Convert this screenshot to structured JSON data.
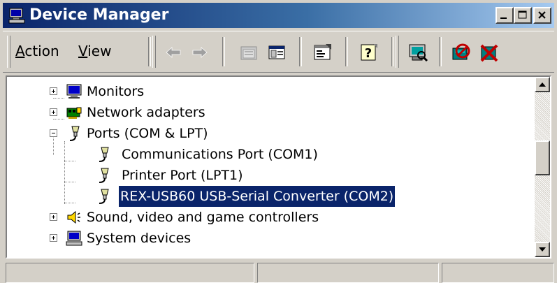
{
  "window": {
    "title": "Device Manager",
    "colors": {
      "titlebar_start": "#0a246a",
      "titlebar_end": "#a6caf0",
      "face": "#d4d0c8",
      "selection": "#0a246a"
    }
  },
  "caption_buttons": [
    {
      "name": "minimize",
      "icon": "minimize-icon"
    },
    {
      "name": "maximize",
      "icon": "maximize-icon"
    },
    {
      "name": "close",
      "icon": "close-icon"
    }
  ],
  "menu": {
    "action": {
      "label_accel": "A",
      "label_rest": "ction"
    },
    "view": {
      "label_accel": "V",
      "label_rest": "iew"
    }
  },
  "toolbar_buttons": [
    {
      "name": "back",
      "icon": "back-arrow-icon",
      "enabled": false
    },
    {
      "name": "forward",
      "icon": "forward-arrow-icon",
      "enabled": false
    },
    {
      "name": "up-folder",
      "icon": "folder-icon",
      "enabled": false
    },
    {
      "name": "show-hide-tree",
      "icon": "console-tree-icon",
      "enabled": true
    },
    {
      "name": "properties",
      "icon": "properties-icon",
      "enabled": true
    },
    {
      "name": "help",
      "icon": "help-icon",
      "enabled": true
    },
    {
      "name": "scan-hardware",
      "icon": "scan-hardware-icon",
      "enabled": true
    },
    {
      "name": "disable",
      "icon": "disable-device-icon",
      "enabled": true
    },
    {
      "name": "uninstall",
      "icon": "uninstall-icon",
      "enabled": true
    }
  ],
  "tree": {
    "items": [
      {
        "label": "Monitors",
        "icon": "monitor-icon",
        "level": 0,
        "expander": "plus",
        "selected": false
      },
      {
        "label": "Network adapters",
        "icon": "network-adapter-icon",
        "level": 0,
        "expander": "plus",
        "selected": false
      },
      {
        "label": "Ports (COM & LPT)",
        "icon": "port-connector-icon",
        "level": 0,
        "expander": "minus",
        "selected": false
      },
      {
        "label": "Communications Port (COM1)",
        "icon": "port-connector-icon",
        "level": 1,
        "expander": "none",
        "selected": false
      },
      {
        "label": "Printer Port (LPT1)",
        "icon": "port-connector-icon",
        "level": 1,
        "expander": "none",
        "selected": false
      },
      {
        "label": "REX-USB60 USB-Serial Converter (COM2)",
        "icon": "port-connector-icon",
        "level": 1,
        "expander": "none",
        "selected": true
      },
      {
        "label": "Sound, video and game controllers",
        "icon": "speaker-icon",
        "level": 0,
        "expander": "plus",
        "selected": false
      },
      {
        "label": "System devices",
        "icon": "computer-icon",
        "level": 0,
        "expander": "plus",
        "selected": false
      }
    ]
  },
  "scrollbar": {
    "position_fraction": 0.42
  },
  "status_panels": [
    "",
    "",
    ""
  ]
}
